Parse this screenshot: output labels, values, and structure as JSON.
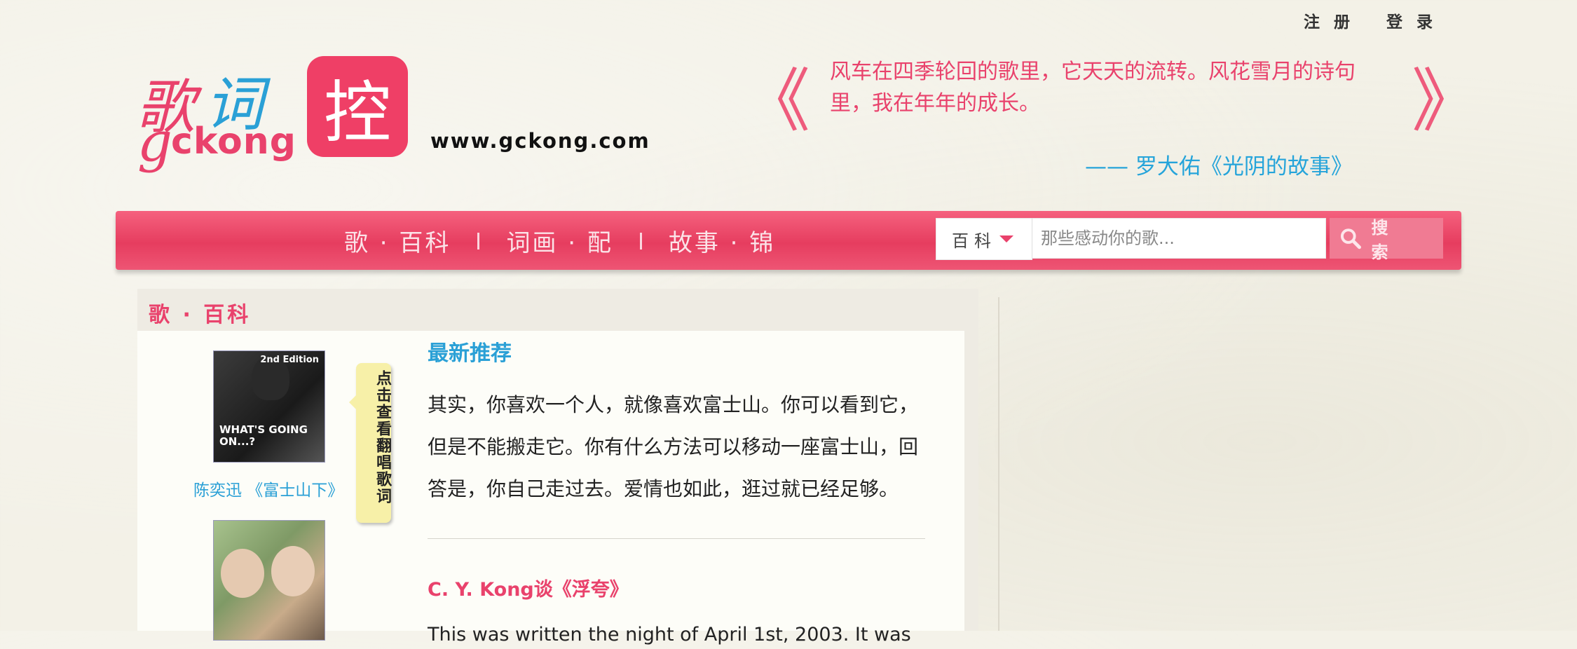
{
  "auth": {
    "register": "注 册",
    "login": "登 录"
  },
  "logo": {
    "char_ge": "歌",
    "char_ci": "词",
    "char_g": "g",
    "ckong": "ckong",
    "box_char": "控",
    "url": "www.gckong.com"
  },
  "quote": {
    "prev": "《",
    "next": "》",
    "text": "风车在四季轮回的歌里，它天天的流转。风花雪月的诗句里，我在年年的成长。",
    "author": "—— 罗大佑《光阴的故事》"
  },
  "nav": {
    "items": [
      {
        "label": "歌 · 百科"
      },
      {
        "label": "词画 · 配"
      },
      {
        "label": "故事 · 锦"
      }
    ]
  },
  "search": {
    "category": "百科",
    "placeholder": "那些感动你的歌...",
    "button": "搜 索"
  },
  "section": {
    "title": "歌 · 百科",
    "album1_caption": "陈奕迅 《富士山下》",
    "album1_edition": "2nd Edition",
    "album1_text": "WHAT'S GOING ON...?",
    "lyric_tag": "点击查看翻唱歌词",
    "latest_heading": "最新推荐",
    "latest_text": "其实，你喜欢一个人，就像喜欢富士山。你可以看到它，但是不能搬走它。你有什么方法可以移动一座富士山，回答是，你自己走过去。爱情也如此，逛过就已经足够。",
    "cy_heading": "C. Y. Kong谈《浮夸》",
    "cy_text": "This was written the night of April 1st, 2003. It was"
  },
  "colors": {
    "brand_pink": "#e9426c",
    "brand_blue": "#2aa0d6",
    "nav_bg": "#e63d5f",
    "tag_yellow": "#f7f0a8"
  }
}
